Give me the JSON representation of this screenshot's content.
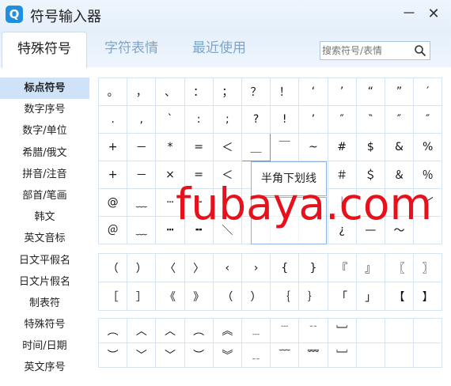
{
  "app": {
    "logo_text": "Q",
    "title": "符号输入器",
    "minimize": "－",
    "close": "✕"
  },
  "tabs": [
    {
      "label": "特殊符号",
      "active": true
    },
    {
      "label": "字符表情",
      "active": false
    },
    {
      "label": "最近使用",
      "active": false
    }
  ],
  "search": {
    "placeholder": "搜索符号/表情",
    "icon": "search-icon"
  },
  "sidebar": {
    "items": [
      {
        "label": "标点符号",
        "active": true
      },
      {
        "label": "数字序号"
      },
      {
        "label": "数字/单位"
      },
      {
        "label": "希腊/俄文"
      },
      {
        "label": "拼音/注音"
      },
      {
        "label": "部首/笔画"
      },
      {
        "label": "韩文"
      },
      {
        "label": "英文音标"
      },
      {
        "label": "日文平假名"
      },
      {
        "label": "日文片假名"
      },
      {
        "label": "制表符"
      },
      {
        "label": "特殊符号"
      },
      {
        "label": "时间/日期"
      },
      {
        "label": "英文序号"
      }
    ]
  },
  "grid1": [
    [
      "。",
      "，",
      "、",
      "：",
      "；",
      "？",
      "！",
      "‘",
      "’",
      "“",
      "”",
      "′"
    ],
    [
      ".",
      ",",
      "ˋ",
      ":",
      ";",
      "?",
      "!",
      "’",
      "″",
      "‶",
      "″",
      "″"
    ],
    [
      "+",
      "－",
      "*",
      "=",
      "＜",
      "＿",
      "￣",
      "~",
      "#",
      "$",
      "&",
      "%"
    ],
    [
      "+",
      "－",
      "×",
      "=",
      "＜",
      "",
      "",
      "",
      "＃",
      "＄",
      "＆",
      "％"
    ],
    [
      "@",
      "﹏",
      "┄",
      "╌",
      "",
      "",
      "",
      "",
      "｜",
      "",
      "",
      "﹀"
    ],
    [
      "＠",
      "﹏",
      "┅",
      "╍",
      "＼",
      "",
      "",
      "",
      "¿",
      "—",
      "～",
      ""
    ]
  ],
  "grid2": [
    [
      "（",
      "）",
      "〈",
      "〉",
      "‹",
      "›",
      "{",
      "}",
      "『",
      "』",
      "〖",
      "〗"
    ],
    [
      "［",
      "］",
      "《",
      "》",
      "（",
      "）",
      "｛",
      "｝",
      "「",
      "」",
      "【",
      "】"
    ]
  ],
  "grid3": [
    [
      "︵",
      "︿",
      "︿",
      "︵",
      "︽",
      "﹍",
      "﹉",
      "﹊",
      "﹈",
      "",
      "",
      ""
    ],
    [
      "︶",
      "﹀",
      "﹀",
      "︶",
      "︾",
      "﹎",
      "﹋",
      "﹌",
      "﹈",
      "",
      "",
      ""
    ]
  ],
  "tooltip": {
    "label": "半角下划线"
  },
  "watermark": {
    "text": "fubaya.com",
    "color": "#e8101a"
  }
}
